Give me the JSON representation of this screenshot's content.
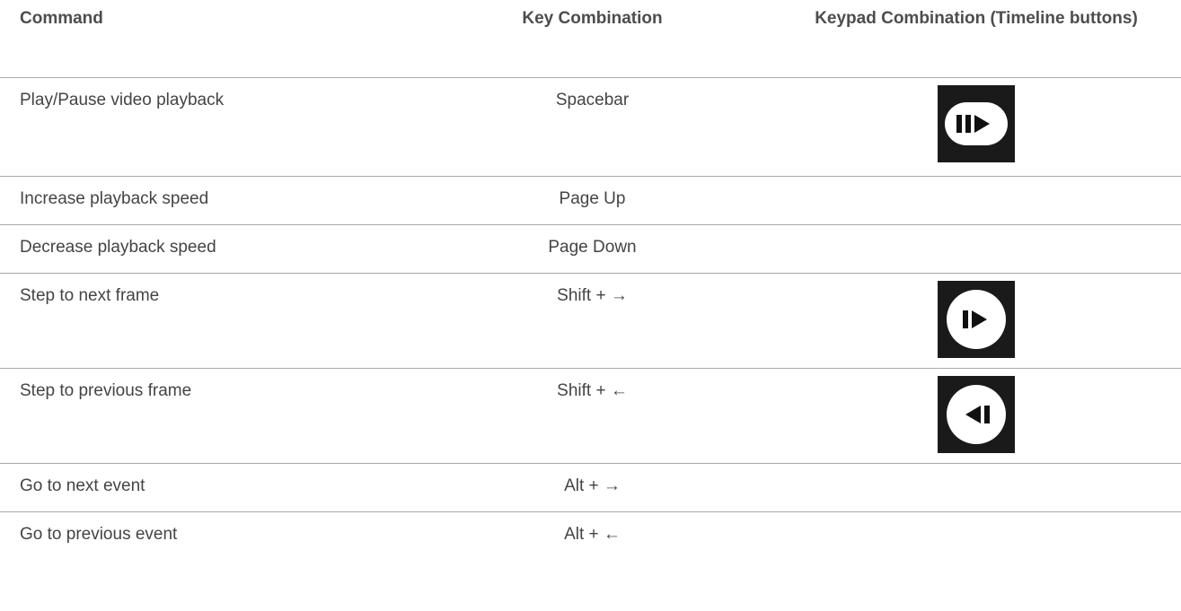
{
  "table": {
    "headers": {
      "command": "Command",
      "key": "Key Combination",
      "keypad": "Keypad Combination (Timeline buttons)"
    },
    "rows": [
      {
        "command": "Play/Pause video playback",
        "key": "Spacebar",
        "keypad_icon": "play-pause-icon"
      },
      {
        "command": "Increase playback speed",
        "key": "Page Up",
        "keypad_icon": ""
      },
      {
        "command": "Decrease playback speed",
        "key": "Page Down",
        "keypad_icon": ""
      },
      {
        "command": "Step to next frame",
        "key": "Shift + →",
        "keypad_icon": "step-forward-icon"
      },
      {
        "command": "Step to previous frame",
        "key": "Shift + ←",
        "keypad_icon": "step-backward-icon"
      },
      {
        "command": "Go to next event",
        "key": "Alt + →",
        "keypad_icon": ""
      },
      {
        "command": "Go to previous event",
        "key": "Alt + ←",
        "keypad_icon": ""
      }
    ]
  }
}
